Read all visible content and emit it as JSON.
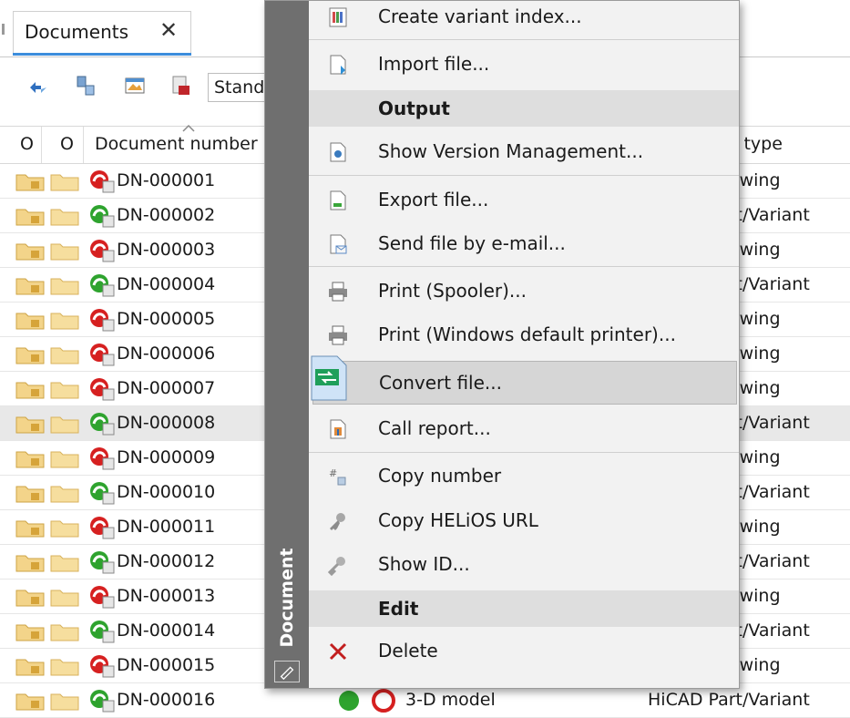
{
  "tab": {
    "label": "Documents",
    "close": "✕"
  },
  "toolbar": {
    "combo_value": "Standard"
  },
  "grid": {
    "headers": {
      "o1": "O",
      "o2": "O",
      "docnum": "Document number",
      "type": "Document type"
    },
    "rows": [
      {
        "num": "DN-000001",
        "type": "HiCAD Drawing",
        "status": "red"
      },
      {
        "num": "DN-000002",
        "type": "HiCAD Part/Variant",
        "status": "green"
      },
      {
        "num": "DN-000003",
        "type": "HiCAD Drawing",
        "status": "red"
      },
      {
        "num": "DN-000004",
        "type": "HiCAD Part/Variant",
        "status": "green"
      },
      {
        "num": "DN-000005",
        "type": "HiCAD Drawing",
        "status": "red"
      },
      {
        "num": "DN-000006",
        "type": "HiCAD Drawing",
        "status": "red"
      },
      {
        "num": "DN-000007",
        "type": "HiCAD Drawing",
        "status": "red"
      },
      {
        "num": "DN-000008",
        "type": "HiCAD Part/Variant",
        "status": "green"
      },
      {
        "num": "DN-000009",
        "type": "HiCAD Drawing",
        "status": "red"
      },
      {
        "num": "DN-000010",
        "type": "HiCAD Part/Variant",
        "status": "green"
      },
      {
        "num": "DN-000011",
        "type": "HiCAD Drawing",
        "status": "red"
      },
      {
        "num": "DN-000012",
        "type": "HiCAD Part/Variant",
        "status": "green"
      },
      {
        "num": "DN-000013",
        "type": "HiCAD Drawing",
        "status": "red"
      },
      {
        "num": "DN-000014",
        "type": "HiCAD Part/Variant",
        "status": "green"
      },
      {
        "num": "DN-000015",
        "type": "HiCAD Drawing",
        "status": "red"
      },
      {
        "num": "DN-000016",
        "type": "HiCAD Part/Variant",
        "status": "green"
      }
    ],
    "last_row_model": "3-D model",
    "selected_row_index": 7
  },
  "menu": {
    "strip_label": "Document",
    "items": {
      "create_variant_index": "Create variant index...",
      "import_file": "Import file...",
      "output_header": "Output",
      "show_version_mgmt": "Show Version Management...",
      "export_file": "Export file...",
      "send_email": "Send file by e-mail...",
      "print_spooler": "Print (Spooler)...",
      "print_windows": "Print (Windows default printer)...",
      "convert_file": "Convert file...",
      "call_report": "Call report...",
      "copy_number": "Copy number",
      "copy_url": "Copy HELiOS URL",
      "show_id": "Show ID...",
      "edit_header": "Edit",
      "delete": "Delete"
    },
    "highlighted": "convert_file"
  },
  "colors": {
    "accent": "#3c8ddc",
    "menu_strip": "#6f6f6f",
    "menu_bg": "#f2f2f2",
    "status_red": "#d62020",
    "status_green": "#2ea32e"
  }
}
